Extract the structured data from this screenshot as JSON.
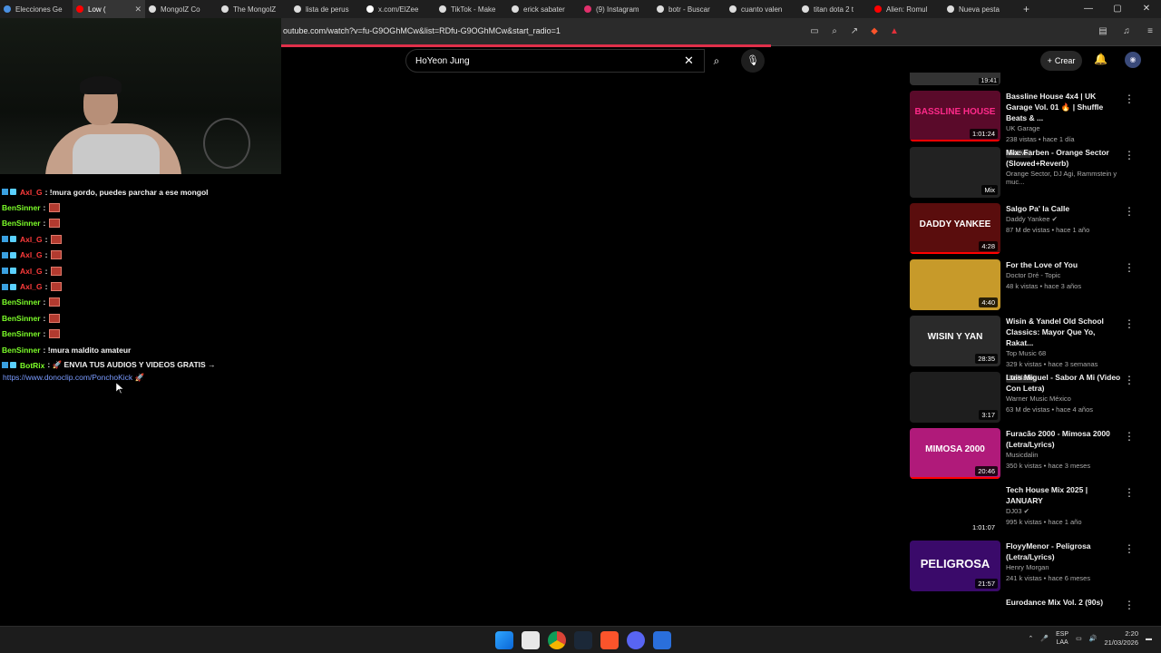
{
  "browser": {
    "tabs": [
      {
        "label": "Elecciones Ge",
        "color": "#4a90e2"
      },
      {
        "label": "Low (",
        "color": "#ff0000"
      },
      {
        "label": "MongolZ Co",
        "color": "#dddddd"
      },
      {
        "label": "The MongolZ",
        "color": "#dddddd"
      },
      {
        "label": "lista de perus",
        "color": "#dddddd"
      },
      {
        "label": "x.com/ElZee",
        "color": "#ffffff"
      },
      {
        "label": "TikTok - Make",
        "color": "#dddddd"
      },
      {
        "label": "erick sabater",
        "color": "#dddddd"
      },
      {
        "label": "(9) Instagram",
        "color": "#e1306c"
      },
      {
        "label": "botr - Buscar",
        "color": "#dddddd"
      },
      {
        "label": "cuanto valen",
        "color": "#dddddd"
      },
      {
        "label": "titan dota 2 t",
        "color": "#dddddd"
      },
      {
        "label": "Alien: Romul",
        "color": "#ff0000"
      },
      {
        "label": "Nueva pesta",
        "color": "#dddddd"
      }
    ],
    "new_tab": "+",
    "url": "outube.com/watch?v=fu-G9OGhMCw&list=RDfu-G9OGhMCw&start_radio=1"
  },
  "youtube": {
    "search_value": "HoYeon Jung",
    "create_label": "Crear"
  },
  "chat": [
    {
      "badges": true,
      "user": "Axl_G",
      "user_color": "#ff3b3b",
      "text": ": !mura gordo, puedes parchar a ese mongol",
      "emote": false
    },
    {
      "badges": false,
      "user": "BenSinner",
      "user_color": "#7dff2a",
      "text": ":",
      "emote": true
    },
    {
      "badges": false,
      "user": "BenSinner",
      "user_color": "#7dff2a",
      "text": ":",
      "emote": true
    },
    {
      "badges": true,
      "user": "Axl_G",
      "user_color": "#ff3b3b",
      "text": ":",
      "emote": true
    },
    {
      "badges": true,
      "user": "Axl_G",
      "user_color": "#ff3b3b",
      "text": ":",
      "emote": true
    },
    {
      "badges": true,
      "user": "Axl_G",
      "user_color": "#ff3b3b",
      "text": ":",
      "emote": true
    },
    {
      "badges": true,
      "user": "Axl_G",
      "user_color": "#ff3b3b",
      "text": ":",
      "emote": true
    },
    {
      "badges": false,
      "user": "BenSinner",
      "user_color": "#7dff2a",
      "text": ":",
      "emote": true
    },
    {
      "badges": false,
      "user": "BenSinner",
      "user_color": "#7dff2a",
      "text": ":",
      "emote": true
    },
    {
      "badges": false,
      "user": "BenSinner",
      "user_color": "#7dff2a",
      "text": ":",
      "emote": true
    },
    {
      "badges": false,
      "user": "BenSinner",
      "user_color": "#7dff2a",
      "text": ": !mura maldito amateur",
      "emote": false
    },
    {
      "badges": true,
      "user": "BotRix",
      "user_color": "#7dff2a",
      "text": ": 🚀 ENVIA TUS AUDIOS Y VIDEOS GRATIS →",
      "emote": false
    }
  ],
  "chat_link": "https://www.donoclip.com/PonchoKick 🚀",
  "playlist_top_duration": "19:41",
  "playlist": [
    {
      "title": "Bassline House 4x4 | UK Garage Vol. 01 🔥 | Shuffle Beats & ...",
      "channel": "UK Garage",
      "stats": "238 vistas • hace 1 día",
      "tag": "Nuevo",
      "duration": "1:01:24",
      "thumb_text": "BASSLINE HOUSE",
      "bg": "#5a0a2a",
      "fg": "#ff2a8a"
    },
    {
      "title": "Mix: Farben - Orange Sector (Slowed+Reverb)",
      "channel": "Orange Sector, DJ Agi, Rammstein y muc...",
      "stats": "",
      "tag": "",
      "duration": "Mix",
      "thumb_text": "",
      "bg": "#222222",
      "fg": "#ffffff"
    },
    {
      "title": "Salgo Pa' la Calle",
      "channel": "Daddy Yankee ✔",
      "stats": "87 M de vistas • hace 1 año",
      "tag": "",
      "duration": "4:28",
      "thumb_text": "DADDY YANKEE",
      "bg": "#5a0d0d",
      "fg": "#ffffff"
    },
    {
      "title": "For the Love of You",
      "channel": "Doctor Dré - Topic",
      "stats": "48 k vistas • hace 3 años",
      "tag": "",
      "duration": "4:40",
      "thumb_text": "",
      "bg": "#c79a2a",
      "fg": "#ffffff"
    },
    {
      "title": "Wisin & Yandel Old School Classics: Mayor Que Yo, Rakat...",
      "channel": "Top Music 68",
      "stats": "329 k vistas • hace 3 semanas",
      "tag": "Doblado",
      "duration": "28:35",
      "thumb_text": "WISIN Y YAN",
      "bg": "#2a2a2a",
      "fg": "#ffffff"
    },
    {
      "title": "Luis Miguel - Sabor A Mi (Video Con Letra)",
      "channel": "Warner Music México",
      "stats": "63 M de vistas • hace 4 años",
      "tag": "",
      "duration": "3:17",
      "thumb_text": "",
      "bg": "#1e1e1e",
      "fg": "#ffffff"
    },
    {
      "title": "Furacão 2000 - Mimosa 2000 (Letra/Lyrics)",
      "channel": "Musicdalin",
      "stats": "350 k vistas • hace 3 meses",
      "tag": "",
      "duration": "20:46",
      "thumb_text": "MIMOSA 2000",
      "bg": "#b01a7a",
      "fg": "#ffffff"
    },
    {
      "title": "Tech House Mix 2025 | JANUARY",
      "channel": "DJ03 ✔",
      "stats": "995 k vistas • hace 1 año",
      "tag": "",
      "duration": "1:01:07",
      "thumb_text": "",
      "bg": "#000000",
      "fg": "#ffffff"
    },
    {
      "title": "FloyyMenor - Peligrosa (Letra/Lyrics)",
      "channel": "Henry Morgan",
      "stats": "241 k vistas • hace 6 meses",
      "tag": "",
      "duration": "21:57",
      "thumb_text": "PELIGROSA",
      "bg": "#3a0a6a",
      "fg": "#ffffff"
    },
    {
      "title": "Eurodance Mix Vol. 2 (90s)",
      "channel": "",
      "stats": "",
      "tag": "",
      "duration": "",
      "thumb_text": "",
      "bg": "#000000",
      "fg": "#ffffff"
    }
  ],
  "taskbar": {
    "lang_top": "ESP",
    "lang_bottom": "LAA",
    "time": "2:20",
    "date": "21/03/2026"
  }
}
